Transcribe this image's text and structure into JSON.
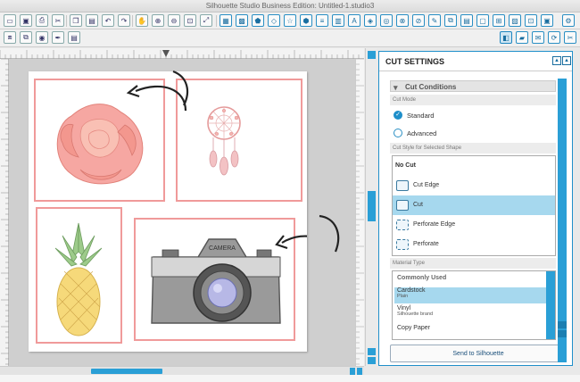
{
  "window": {
    "title": "Silhouette Studio Business Edition: Untitled-1.studio3"
  },
  "canvas": {
    "page_background": "#ffffff",
    "cut_line_color": "#f09a9a",
    "canvas_color": "#cfcfcf",
    "images": [
      "rose-icon",
      "dreamcatcher-icon",
      "pineapple-icon",
      "camera-icon"
    ],
    "camera_text": "CAMERA"
  },
  "cut_settings": {
    "title": "CUT SETTINGS",
    "section_cut_conditions": "Cut Conditions",
    "cut_mode_label": "Cut Mode",
    "mode_standard": "Standard",
    "mode_advanced": "Advanced",
    "selected_mode": "Standard",
    "cut_style_label": "Cut Style for Selected Shape",
    "styles": [
      "No Cut",
      "Cut Edge",
      "Cut",
      "Perforate Edge",
      "Perforate"
    ],
    "selected_style": "Cut",
    "material_type_label": "Material Type",
    "materials": {
      "group": "Commonly Used",
      "items": [
        {
          "name": "Cardstock",
          "sub": "Plain"
        },
        {
          "name": "Vinyl",
          "sub": "Silhouette brand"
        },
        {
          "name": "Copy Paper",
          "sub": ""
        }
      ],
      "selected": "Cardstock"
    },
    "send_button": "Send to Silhouette"
  },
  "colors": {
    "accent": "#2a9fd6",
    "cut_line": "#f09a9a",
    "selected_row": "#a6d8ee"
  }
}
